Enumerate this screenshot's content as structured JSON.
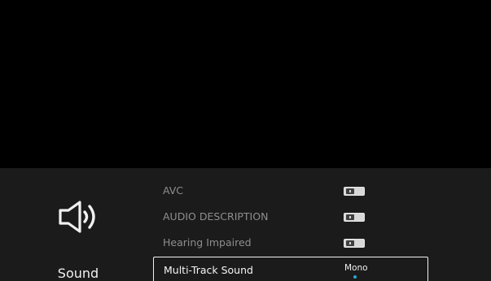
{
  "category": {
    "label": "Sound",
    "icon": "speaker-icon"
  },
  "settings": {
    "items": [
      {
        "label": "AVC",
        "control": "toggle",
        "state": "off"
      },
      {
        "label": "AUDIO DESCRIPTION",
        "control": "toggle",
        "state": "off"
      },
      {
        "label": "Hearing Impaired",
        "control": "toggle",
        "state": "off"
      },
      {
        "label": "Multi-Track Sound",
        "control": "value",
        "value": "Mono",
        "focused": true
      }
    ]
  },
  "colors": {
    "background": "#000000",
    "panel": "#1b1b1b",
    "label_dim": "#8e8e8e",
    "label_focused": "#f5f5f5",
    "focus_border": "#f2f2f2",
    "indicator_dot": "#2aa8d8"
  }
}
